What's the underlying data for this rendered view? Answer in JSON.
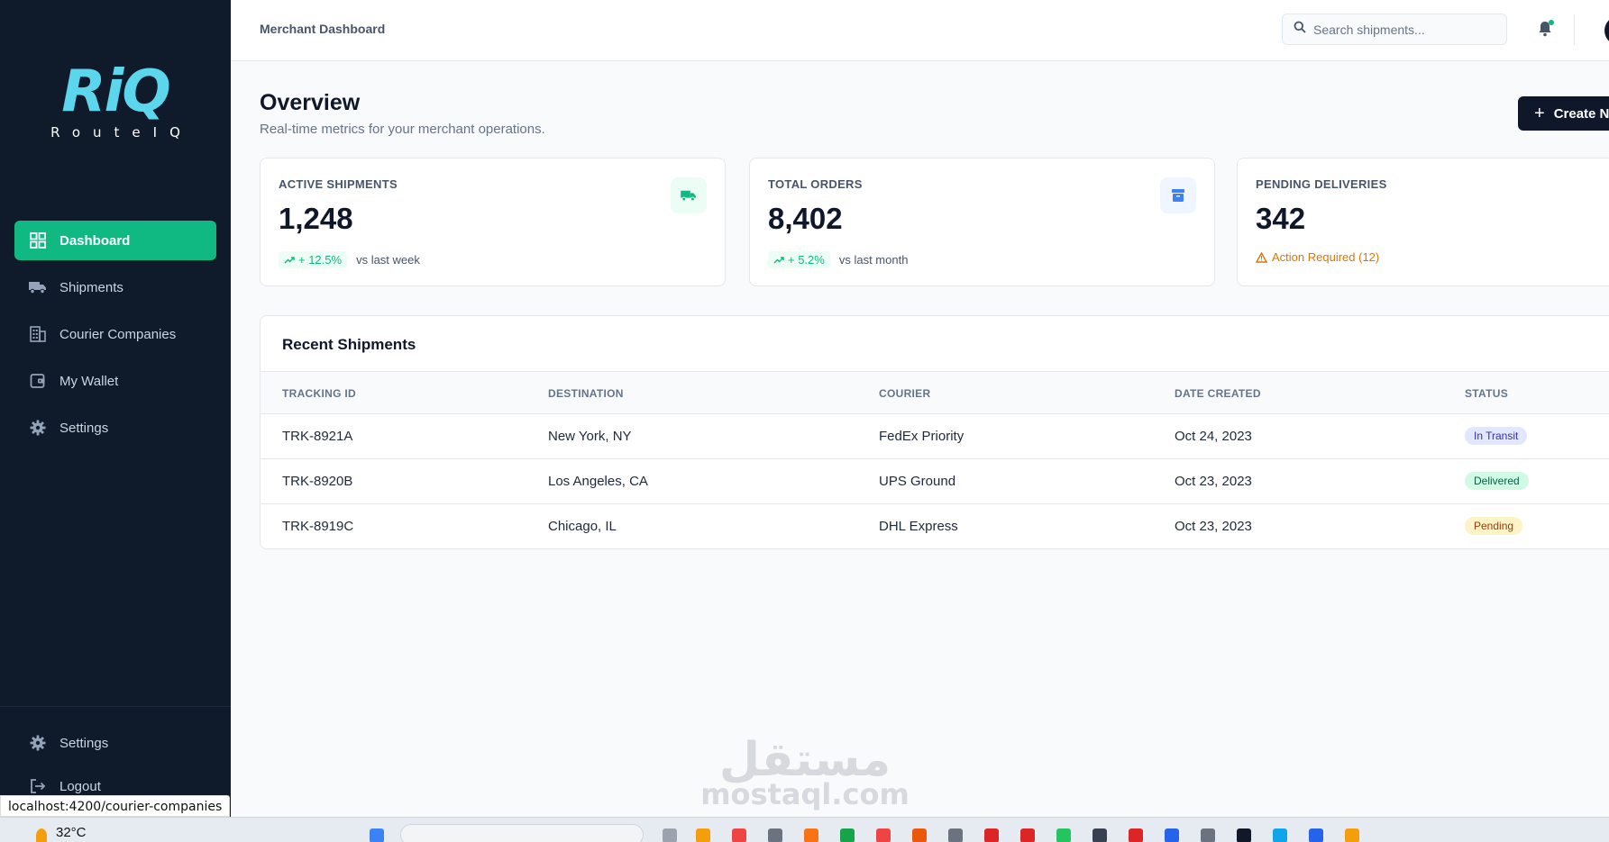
{
  "sidebar": {
    "logo_mark": "RiQ",
    "logo_sub": "RouteIQ",
    "items": [
      {
        "label": "Dashboard",
        "icon": "grid-icon",
        "active": true
      },
      {
        "label": "Shipments",
        "icon": "truck-icon"
      },
      {
        "label": "Courier Companies",
        "icon": "building-icon"
      },
      {
        "label": "My Wallet",
        "icon": "wallet-icon"
      },
      {
        "label": "Settings",
        "icon": "gear-icon"
      }
    ],
    "bottom": [
      {
        "label": "Settings",
        "icon": "gear-icon"
      },
      {
        "label": "Logout",
        "icon": "logout-icon"
      }
    ],
    "status_url": "localhost:4200/courier-companies"
  },
  "header": {
    "title": "Merchant Dashboard",
    "search_placeholder": "Search shipments..."
  },
  "overview": {
    "title": "Overview",
    "subtitle": "Real-time metrics for your merchant operations.",
    "create_label": "Create N"
  },
  "cards": [
    {
      "label": "ACTIVE SHIPMENTS",
      "value": "1,248",
      "trend": "+ 12.5%",
      "trend_text": "vs last week",
      "icon": "truck-icon",
      "icon_bg": "#ecfdf5",
      "icon_color": "#10b981"
    },
    {
      "label": "TOTAL ORDERS",
      "value": "8,402",
      "trend": "+ 5.2%",
      "trend_text": "vs last month",
      "icon": "archive-icon",
      "icon_bg": "#eff6ff",
      "icon_color": "#3b82f6"
    },
    {
      "label": "PENDING DELIVERIES",
      "value": "342",
      "warning": "Action Required (12)"
    }
  ],
  "table": {
    "title": "Recent Shipments",
    "columns": [
      "TRACKING ID",
      "DESTINATION",
      "COURIER",
      "DATE CREATED",
      "STATUS"
    ],
    "rows": [
      {
        "id": "TRK-8921A",
        "destination": "New York, NY",
        "courier": "FedEx Priority",
        "date": "Oct 24, 2023",
        "status": "In Transit"
      },
      {
        "id": "TRK-8920B",
        "destination": "Los Angeles, CA",
        "courier": "UPS Ground",
        "date": "Oct 23, 2023",
        "status": "Delivered"
      },
      {
        "id": "TRK-8919C",
        "destination": "Chicago, IL",
        "courier": "DHL Express",
        "date": "Oct 23, 2023",
        "status": "Pending"
      }
    ]
  },
  "watermark": {
    "arabic": "مستقل",
    "latin": "mostaql.com"
  },
  "taskbar": {
    "temperature": "32°C"
  },
  "colors": {
    "accent": "#10b981",
    "sidebar_bg": "#0f1a2b",
    "primary_dark": "#0f172a"
  }
}
